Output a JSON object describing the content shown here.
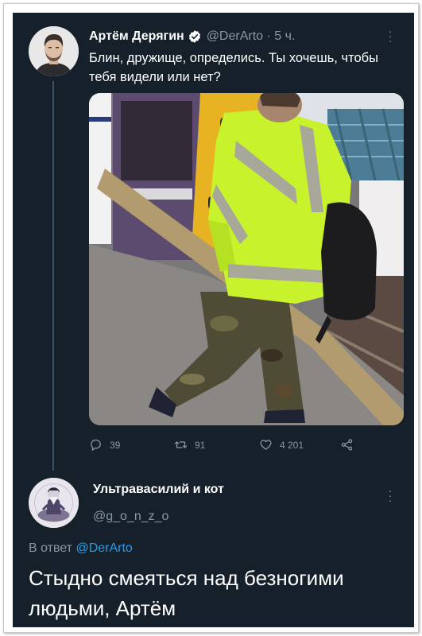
{
  "tweet": {
    "author_name": "Артём Дерягин",
    "handle": "@DerArto",
    "separator": " · ",
    "time": "5 ч.",
    "text": "Блин, дружище, определись. Ты хочешь, чтобы тебя видели или нет?",
    "actions": {
      "replies": "39",
      "retweets": "91",
      "likes": "4 201"
    },
    "verified_color": "#ffffff",
    "photo_icon": "man-in-hi-vis-jacket-on-platform"
  },
  "reply": {
    "author_name": "Ультравасилий и кот",
    "handle": "@g_o_n_z_o",
    "reply_prefix": "В ответ ",
    "reply_mention": "@DerArto",
    "text": "Стыдно смеяться над безногими людьми, Артём"
  },
  "theme": {
    "background": "#15202b",
    "text": "#ffffff",
    "secondary": "#8899a6",
    "accent": "#1da1f2"
  }
}
